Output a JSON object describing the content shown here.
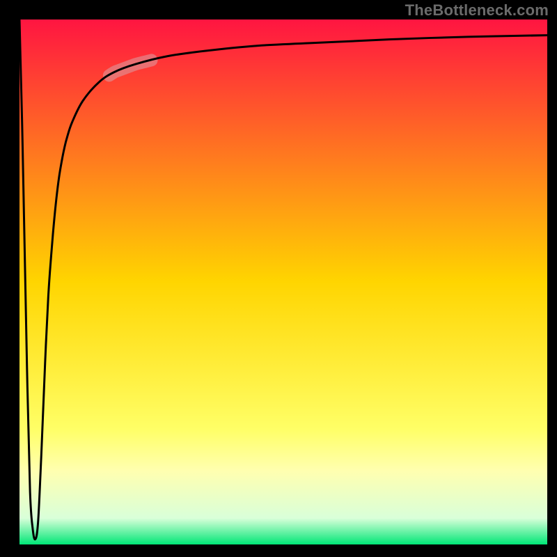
{
  "watermark": "TheBottleneck.com",
  "chart_data": {
    "type": "line",
    "title": "",
    "xlabel": "",
    "ylabel": "",
    "xlim": [
      0,
      100
    ],
    "ylim": [
      0,
      100
    ],
    "grid": false,
    "legend": false,
    "background_gradient_stops": [
      {
        "pos": 0.0,
        "color": "#ff1541"
      },
      {
        "pos": 0.5,
        "color": "#ffd500"
      },
      {
        "pos": 0.78,
        "color": "#ffff66"
      },
      {
        "pos": 0.86,
        "color": "#ffffb0"
      },
      {
        "pos": 0.95,
        "color": "#d9ffd9"
      },
      {
        "pos": 1.0,
        "color": "#00e676"
      }
    ],
    "series": [
      {
        "name": "bottleneck-curve",
        "color": "#000000",
        "x": [
          0.0,
          0.5,
          1.0,
          1.5,
          2.0,
          2.5,
          3.0,
          3.5,
          4.0,
          4.5,
          5.0,
          5.5,
          6.0,
          6.5,
          7.0,
          7.5,
          8.0,
          8.5,
          9.0,
          10.0,
          12.0,
          15.0,
          18.0,
          22.0,
          28.0,
          35.0,
          45.0,
          55.0,
          70.0,
          85.0,
          100.0
        ],
        "values": [
          100.0,
          80.0,
          55.0,
          30.0,
          10.0,
          3.0,
          1.0,
          4.0,
          14.0,
          26.0,
          38.0,
          48.0,
          55.0,
          61.0,
          66.0,
          70.0,
          73.0,
          75.5,
          77.5,
          80.5,
          84.5,
          88.0,
          90.0,
          91.5,
          93.0,
          94.0,
          95.0,
          95.5,
          96.2,
          96.7,
          97.0
        ]
      }
    ],
    "highlight": {
      "name": "highlight-segment",
      "color": "#d9a1a6",
      "opacity": 0.55,
      "x_range": [
        17.0,
        25.0
      ]
    }
  }
}
